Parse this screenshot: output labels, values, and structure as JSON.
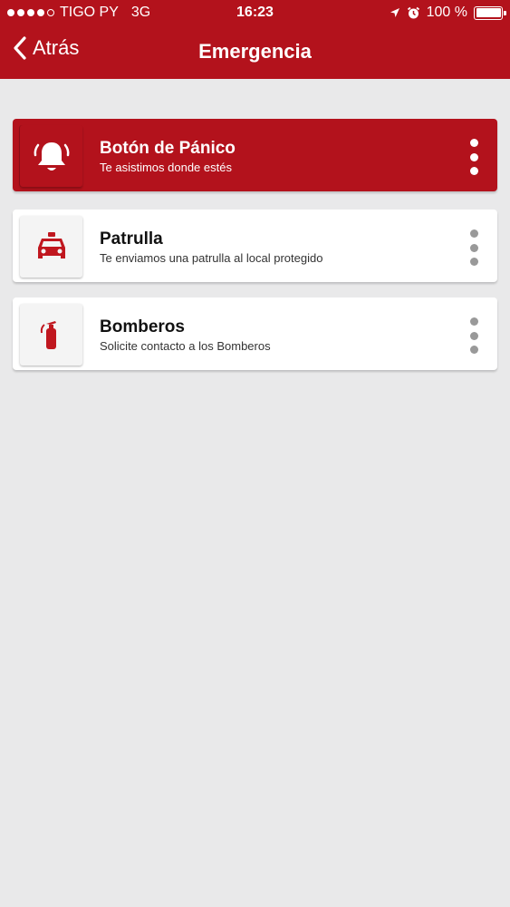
{
  "status_bar": {
    "carrier": "TIGO PY",
    "network": "3G",
    "time": "16:23",
    "battery": "100 %",
    "battery_level": 1.0
  },
  "nav": {
    "back_label": "Atrás",
    "title": "Emergencia"
  },
  "items": [
    {
      "title": "Botón de Pánico",
      "subtitle": "Te asistimos donde estés",
      "icon": "bell-icon"
    },
    {
      "title": "Patrulla",
      "subtitle": "Te enviamos una patrulla al local protegido",
      "icon": "police-car-icon"
    },
    {
      "title": "Bomberos",
      "subtitle": "Solicite contacto a los Bomberos",
      "icon": "fire-extinguisher-icon"
    }
  ],
  "colors": {
    "brand_red": "#b3121c",
    "background": "#e9e9ea",
    "icon_red": "#c0171f"
  }
}
